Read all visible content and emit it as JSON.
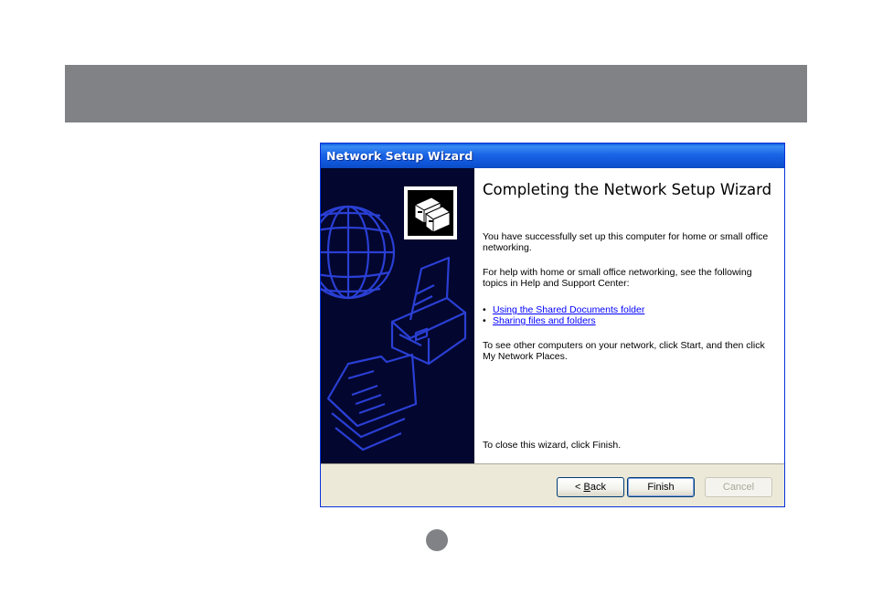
{
  "window": {
    "title": "Network Setup Wizard"
  },
  "content": {
    "heading": "Completing the Network Setup Wizard",
    "para_success": "You have successfully set up this computer for home or small office networking.",
    "para_help": "For help with home or small office networking, see the following topics in Help and Support Center:",
    "links": [
      {
        "label": "Using the Shared Documents folder"
      },
      {
        "label": "Sharing files and folders"
      }
    ],
    "para_network": "To see other computers on your network, click Start, and then click My Network Places.",
    "para_close": "To close this wizard, click Finish."
  },
  "buttons": {
    "back_accel": "B",
    "back_rest": "ack",
    "finish": "Finish",
    "cancel": "Cancel"
  },
  "icons": {
    "wizard_icon": "network-computers-icon",
    "side_art": [
      "globe-icon",
      "printer-icon",
      "folder-icon"
    ]
  },
  "colors": {
    "titlebar": "#0a5ddc",
    "side_panel": "#03062e",
    "link": "#0000ff",
    "button_bar": "#ece9d8",
    "band": "#808285"
  }
}
